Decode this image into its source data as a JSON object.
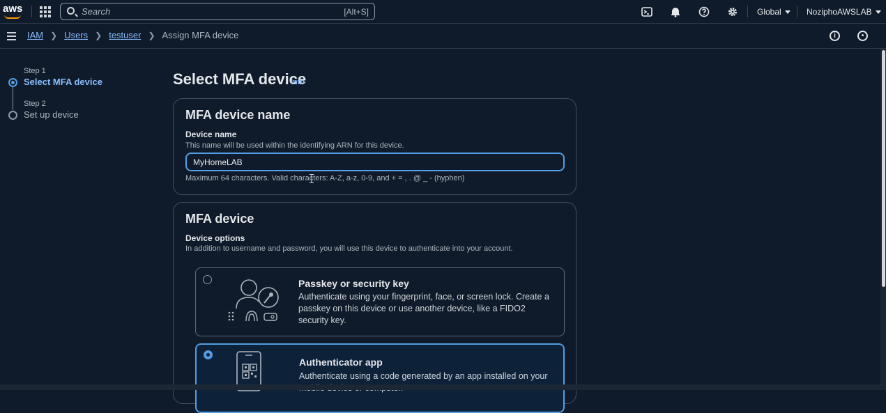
{
  "topnav": {
    "logo_text": "aws",
    "search_placeholder": "Search",
    "search_shortcut": "[Alt+S]",
    "region": "Global",
    "account": "NoziphoAWSLAB"
  },
  "breadcrumb": {
    "items": [
      "IAM",
      "Users",
      "testuser"
    ],
    "current": "Assign MFA device"
  },
  "steps": [
    {
      "num": "Step 1",
      "label": "Select MFA device",
      "active": true
    },
    {
      "num": "Step 2",
      "label": "Set up device",
      "active": false
    }
  ],
  "page": {
    "title": "Select MFA device",
    "info": "Info"
  },
  "name_panel": {
    "title": "MFA device name",
    "field_label": "Device name",
    "field_desc": "This name will be used within the identifying ARN for this device.",
    "value": "MyHomeLAB",
    "constraint": "Maximum 64 characters. Valid characters: A-Z, a-z, 0-9, and + = , . @ _ - (hyphen)"
  },
  "device_panel": {
    "title": "MFA device",
    "options_label": "Device options",
    "options_desc": "In addition to username and password, you will use this device to authenticate into your account.",
    "options": [
      {
        "title": "Passkey or security key",
        "desc": "Authenticate using your fingerprint, face, or screen lock. Create a passkey on this device or use another device, like a FIDO2 security key.",
        "selected": false,
        "icon": "passkey-icon"
      },
      {
        "title": "Authenticator app",
        "desc": "Authenticate using a code generated by an app installed on your mobile device or computer.",
        "selected": true,
        "icon": "authenticator-app-icon"
      }
    ]
  },
  "colors": {
    "accent": "#539fe5",
    "link": "#89bdff",
    "background": "#0f1b2a",
    "brand": "#ff9900"
  }
}
